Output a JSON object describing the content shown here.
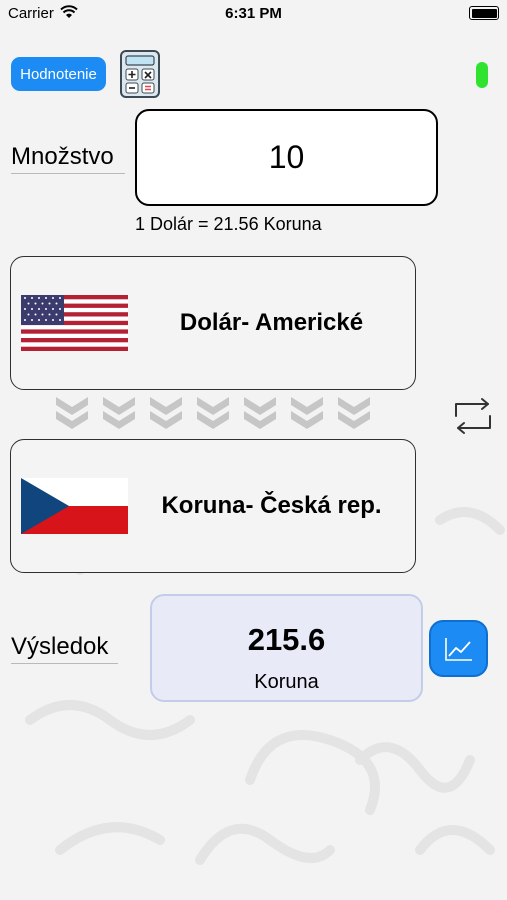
{
  "status_bar": {
    "carrier": "Carrier",
    "time": "6:31 PM"
  },
  "header": {
    "rate_button_label": "Hodnotenie"
  },
  "amount": {
    "label": "Množstvo",
    "value": "10"
  },
  "exchange_rate": "1 Dolár = 21.56 Koruna",
  "from_currency": {
    "name": "Dolár- Americké",
    "flag": "us-flag-icon"
  },
  "to_currency": {
    "name": "Koruna- Česká rep.",
    "flag": "czech-flag-icon"
  },
  "result": {
    "label": "Výsledok",
    "value": "215.6",
    "unit": "Koruna"
  },
  "colors": {
    "accent": "#1c8bf3",
    "online_dot": "#2fe32f",
    "result_bg": "#e8eaf8"
  }
}
